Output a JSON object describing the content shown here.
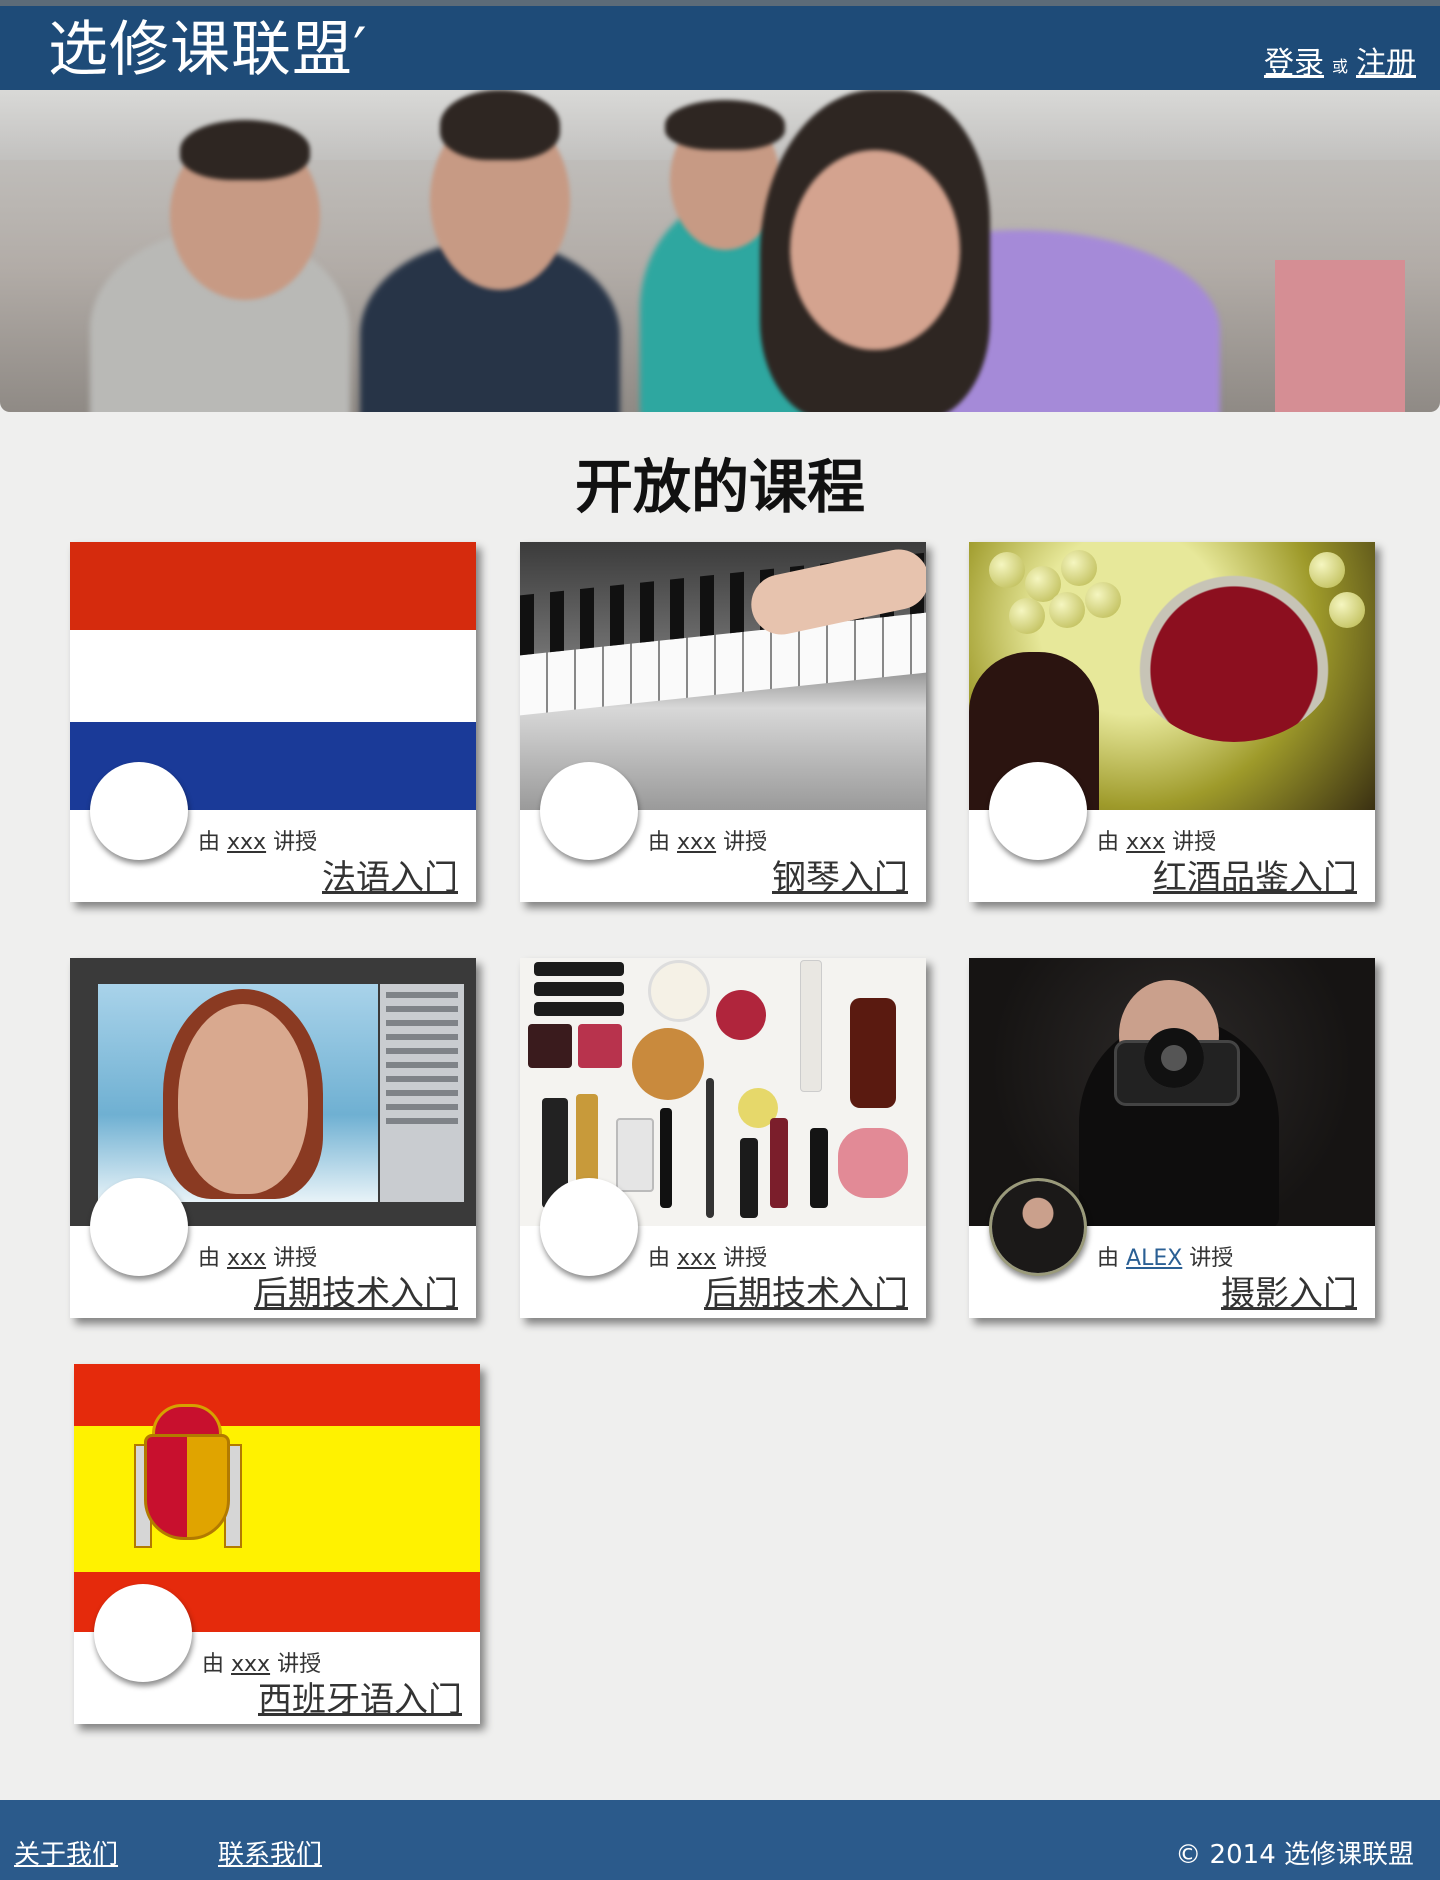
{
  "header": {
    "brand": "选修课联盟′",
    "login": "登录",
    "or": "或",
    "register": "注册",
    "bg_color": "#1e4b78"
  },
  "section_title": "开放的课程",
  "byline_prefix": "由",
  "byline_suffix": "讲授",
  "courses": [
    {
      "title": "法语入门",
      "teacher": "xxx",
      "image": "france-flag"
    },
    {
      "title": "钢琴入门",
      "teacher": "xxx",
      "image": "piano-keys"
    },
    {
      "title": "红酒品鉴入门",
      "teacher": "xxx",
      "image": "red-wine"
    },
    {
      "title": "后期技术入门",
      "teacher": "xxx",
      "image": "photoshop-portrait"
    },
    {
      "title": "后期技术入门",
      "teacher": "xxx",
      "image": "cosmetics"
    },
    {
      "title": "摄影入门",
      "teacher": "ALEX",
      "image": "photographer"
    },
    {
      "title": "西班牙语入门",
      "teacher": "xxx",
      "image": "spain-flag"
    }
  ],
  "footer": {
    "about": "关于我们",
    "contact": "联系我们",
    "copyright": "© 2014 选修课联盟",
    "bg_color": "#2b5a8b"
  }
}
